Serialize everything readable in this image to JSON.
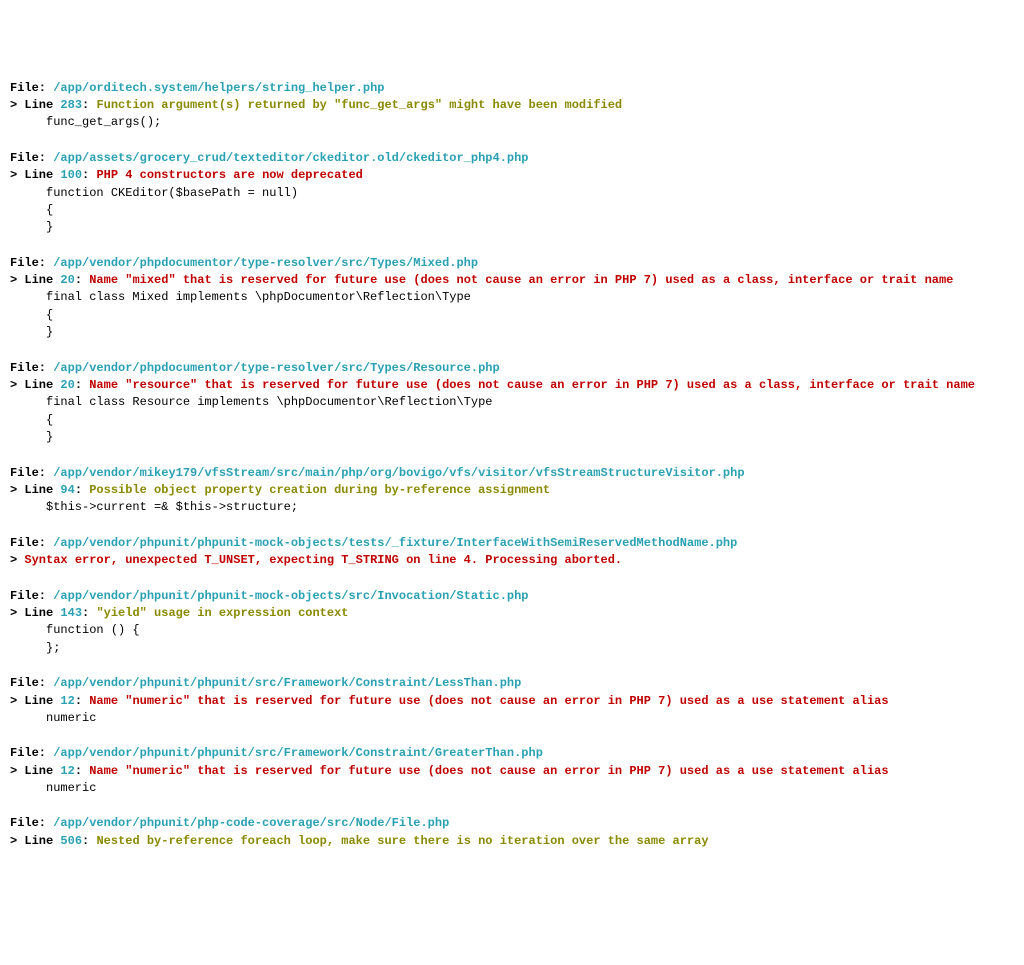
{
  "labels": {
    "file": "File: ",
    "line": " Line "
  },
  "entries": [
    {
      "file": "/app/orditech.system/helpers/string_helper.php",
      "line": "283",
      "severity": "warn",
      "message": "Function argument(s) returned by \"func_get_args\" might have been modified",
      "code": [
        "     func_get_args();"
      ]
    },
    {
      "file": "/app/assets/grocery_crud/texteditor/ckeditor.old/ckeditor_php4.php",
      "line": "100",
      "severity": "err",
      "message": "PHP 4 constructors are now deprecated",
      "code": [
        "     function CKEditor($basePath = null)",
        "     {",
        "     }"
      ]
    },
    {
      "file": "/app/vendor/phpdocumentor/type-resolver/src/Types/Mixed.php",
      "line": "20",
      "severity": "err",
      "message": "Name \"mixed\" that is reserved for future use (does not cause an error in PHP 7) used as a class, interface or trait name",
      "code": [
        "     final class Mixed implements \\phpDocumentor\\Reflection\\Type",
        "     {",
        "     }"
      ]
    },
    {
      "file": "/app/vendor/phpdocumentor/type-resolver/src/Types/Resource.php",
      "line": "20",
      "severity": "err",
      "message": "Name \"resource\" that is reserved for future use (does not cause an error in PHP 7) used as a class, interface or trait name",
      "code": [
        "     final class Resource implements \\phpDocumentor\\Reflection\\Type",
        "     {",
        "     }"
      ]
    },
    {
      "file": "/app/vendor/mikey179/vfsStream/src/main/php/org/bovigo/vfs/visitor/vfsStreamStructureVisitor.php",
      "line": "94",
      "severity": "warn",
      "message": "Possible object property creation during by-reference assignment",
      "code": [
        "     $this->current =& $this->structure;"
      ]
    },
    {
      "file": "/app/vendor/phpunit/phpunit-mock-objects/tests/_fixture/InterfaceWithSemiReservedMethodName.php",
      "line": null,
      "severity": "err",
      "message": "Syntax error, unexpected T_UNSET, expecting T_STRING on line 4. Processing aborted.",
      "code": []
    },
    {
      "file": "/app/vendor/phpunit/phpunit-mock-objects/src/Invocation/Static.php",
      "line": "143",
      "severity": "warn",
      "message": "\"yield\" usage in expression context",
      "code": [
        "     function () {",
        "     };"
      ]
    },
    {
      "file": "/app/vendor/phpunit/phpunit/src/Framework/Constraint/LessThan.php",
      "line": "12",
      "severity": "err",
      "message": "Name \"numeric\" that is reserved for future use (does not cause an error in PHP 7) used as a use statement alias",
      "code": [
        "     numeric"
      ]
    },
    {
      "file": "/app/vendor/phpunit/phpunit/src/Framework/Constraint/GreaterThan.php",
      "line": "12",
      "severity": "err",
      "message": "Name \"numeric\" that is reserved for future use (does not cause an error in PHP 7) used as a use statement alias",
      "code": [
        "     numeric"
      ]
    },
    {
      "file": "/app/vendor/phpunit/php-code-coverage/src/Node/File.php",
      "line": "506",
      "severity": "warn",
      "message": "Nested by-reference foreach loop, make sure there is no iteration over the same array",
      "code": []
    }
  ]
}
